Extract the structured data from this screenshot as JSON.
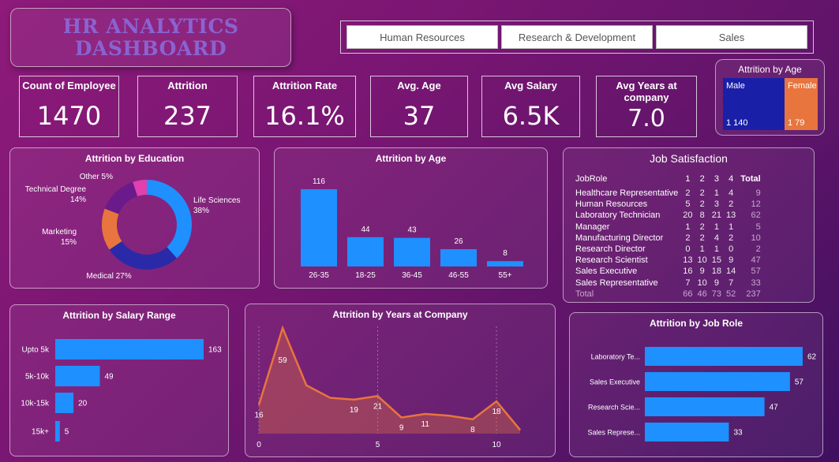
{
  "dashboard": {
    "title_line1": "HR ANALYTICS",
    "title_line2": "DASHBOARD"
  },
  "slicer": {
    "items": [
      "Human Resources",
      "Research & Development",
      "Sales"
    ]
  },
  "kpis": [
    {
      "label": "Count of Employee",
      "value": "1470"
    },
    {
      "label": "Attrition",
      "value": "237"
    },
    {
      "label": "Attrition Rate",
      "value": "16.1%"
    },
    {
      "label": "Avg. Age",
      "value": "37"
    },
    {
      "label": "Avg Salary",
      "value": "6.5K"
    },
    {
      "label": "Avg Years at company",
      "value": "7.0"
    }
  ],
  "attrition_by_gender": {
    "title": "Attrition by Age",
    "male_label": "Male",
    "male_value": "1 140",
    "female_label": "Female",
    "female_value": "1 79",
    "male_color": "#1a1fa8",
    "female_color": "#e8753d"
  },
  "job_satisfaction": {
    "title": "Job Satisfaction",
    "headers": [
      "JobRole",
      "1",
      "2",
      "3",
      "4",
      "Total"
    ],
    "rows": [
      [
        "Healthcare Representative",
        "2",
        "2",
        "1",
        "4",
        "9"
      ],
      [
        "Human Resources",
        "5",
        "2",
        "3",
        "2",
        "12"
      ],
      [
        "Laboratory Technician",
        "20",
        "8",
        "21",
        "13",
        "62"
      ],
      [
        "Manager",
        "1",
        "2",
        "1",
        "1",
        "5"
      ],
      [
        "Manufacturing Director",
        "2",
        "2",
        "4",
        "2",
        "10"
      ],
      [
        "Research Director",
        "0",
        "1",
        "1",
        "0",
        "2"
      ],
      [
        "Research Scientist",
        "13",
        "10",
        "15",
        "9",
        "47"
      ],
      [
        "Sales Executive",
        "16",
        "9",
        "18",
        "14",
        "57"
      ],
      [
        "Sales Representative",
        "7",
        "10",
        "9",
        "7",
        "33"
      ]
    ],
    "total_row": [
      "Total",
      "66",
      "46",
      "73",
      "52",
      "237"
    ]
  },
  "chart_data": [
    {
      "type": "pie",
      "title": "Attrition by Education",
      "categories": [
        "Life Sciences",
        "Medical",
        "Marketing",
        "Technical Degree",
        "Other"
      ],
      "values": [
        38,
        27,
        15,
        14,
        5
      ],
      "labels": [
        "Life Sciences 38%",
        "Medical 27%",
        "Marketing 15%",
        "Technical Degree 14%",
        "Other 5%"
      ],
      "colors": [
        "#1e90ff",
        "#2a2aa8",
        "#e8753d",
        "#6a1a8a",
        "#e040b0"
      ]
    },
    {
      "type": "bar",
      "title": "Attrition by Age",
      "categories": [
        "26-35",
        "18-25",
        "36-45",
        "46-55",
        "55+"
      ],
      "values": [
        116,
        44,
        43,
        26,
        8
      ],
      "color": "#1e90ff"
    },
    {
      "type": "bar",
      "title": "Attrition by Salary Range",
      "orientation": "horizontal",
      "categories": [
        "Upto 5k",
        "5k-10k",
        "10k-15k",
        "15k+"
      ],
      "values": [
        163,
        49,
        20,
        5
      ],
      "color": "#1e90ff"
    },
    {
      "type": "area",
      "title": "Attrition by Years at Company",
      "x": [
        0,
        1,
        2,
        3,
        4,
        5,
        6,
        7,
        8,
        9,
        10,
        11
      ],
      "values": [
        16,
        59,
        27,
        20,
        19,
        21,
        9,
        11,
        10,
        8,
        18,
        2
      ],
      "labeled_points": [
        {
          "x": 0,
          "label": "16"
        },
        {
          "x": 1,
          "label": "59"
        },
        {
          "x": 4,
          "label": "19"
        },
        {
          "x": 5,
          "label": "21"
        },
        {
          "x": 6,
          "label": "9"
        },
        {
          "x": 7,
          "label": "11"
        },
        {
          "x": 9,
          "label": "8"
        },
        {
          "x": 10,
          "label": "18"
        }
      ],
      "x_ticks": [
        "0",
        "5",
        "10"
      ],
      "color": "#e8753d"
    },
    {
      "type": "bar",
      "title": "Attrition by Job Role",
      "orientation": "horizontal",
      "categories": [
        "Laboratory Te...",
        "Sales Executive",
        "Research Scie...",
        "Sales Represe..."
      ],
      "values": [
        62,
        57,
        47,
        33
      ],
      "color": "#1e90ff"
    }
  ]
}
